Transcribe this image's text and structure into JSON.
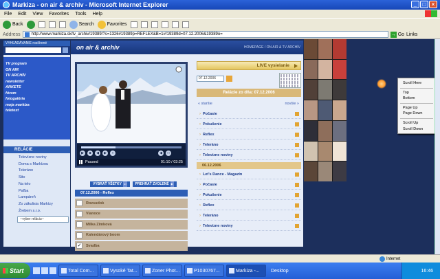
{
  "window": {
    "title": "Markiza - on air & archiv - Microsoft Internet Explorer",
    "buttons": [
      "_",
      "□",
      "×"
    ]
  },
  "menu": [
    "File",
    "Edit",
    "View",
    "Favorites",
    "Tools",
    "Help"
  ],
  "toolbar": {
    "back": "Back",
    "search": "Search",
    "favorites": "Favorites"
  },
  "address": {
    "label": "Address",
    "url": "http://www.markiza.sk/tv_archiv/19389/?s=1326#19389p=REFLEX&B=1#/19389d=07.12.2006&19389o=",
    "go": "Go",
    "links": "Links"
  },
  "site": {
    "search_head": "VYHĽADÁVANIE          rozšírené",
    "nav": [
      "TV program",
      "ON AIR",
      "TV ARCHÍV",
      "newsletter",
      "ANKETE",
      "fórum",
      "fotogaléria",
      "moja markíza",
      "teletext"
    ],
    "section_title": "on air & archiv",
    "breadcrumbs": "HOMEPAGE / ON AIR & TV ARCHÍV",
    "relacie_head": "RELÁCIE",
    "relacie": [
      "Televízne noviny",
      "Doma s Markízou",
      "Teleráno",
      "Sito",
      "Na telo",
      "Paľba",
      "Lampáreň",
      "Zo zákulisia Markízy",
      "Žrebem s.r.o."
    ],
    "relacie_select": "--vyber reláciu--",
    "player": {
      "status": "Paused",
      "time": "01:10 / 03:25",
      "progress": 0.34
    },
    "select_all": "VYBRAŤ VŠETKY",
    "play_selected": "PREHRAŤ ZVOLENÉ",
    "clip_date": "07.12.2006 - Reflex",
    "clips": [
      {
        "label": "Rozsudok",
        "checked": ""
      },
      {
        "label": "Vianoce",
        "checked": ""
      },
      {
        "label": "Milka Zimková",
        "checked": ""
      },
      {
        "label": "Kalendárový boom",
        "checked": ""
      },
      {
        "label": "Svadba",
        "checked": "✓"
      }
    ],
    "live": "LIVE vysielanie",
    "date_value": "07.12.2006",
    "relacie_date": "Relácie zo dňa: 07.12.2006",
    "older": "« staršie",
    "newer": "novšie »",
    "programs_day1": [
      "Počasie",
      "Pokušenie",
      "Reflex",
      "Teleráno",
      "Televízne noviny"
    ],
    "day2": "06.12.2006",
    "programs_day2": [
      "Let's Dance - Magazín",
      "Počasie",
      "Pokušenie",
      "Reflex",
      "Teleráno",
      "Televízne noviny"
    ]
  },
  "context_menu": [
    "Scroll Here",
    "Top",
    "Bottom",
    "Page Up",
    "Page Down",
    "Scroll Up",
    "Scroll Down"
  ],
  "statusbar": {
    "zone": "Internet"
  },
  "taskbar": {
    "start": "Start",
    "tasks": [
      "Total Com...",
      "Vysoké Tat...",
      "Zoner Phot...",
      "P1030767...",
      "Markiza -..."
    ],
    "desktop": "Desktop",
    "clock": "16:46"
  },
  "colors": {
    "accent": "#2d5eb5",
    "clip_bg": "#c5b49d",
    "live_gold": "#e4c65e"
  }
}
